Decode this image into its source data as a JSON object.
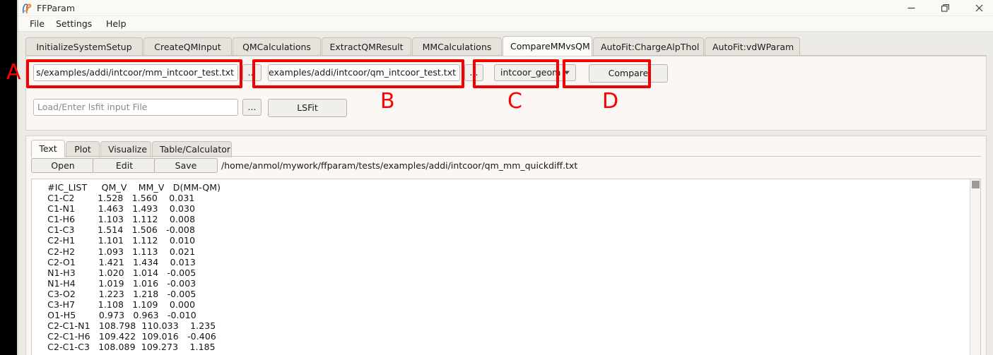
{
  "window": {
    "title": "FFParam",
    "icon": "ffparam-logo-icon",
    "controls": {
      "minimize": "–",
      "maximize": "❐",
      "close": "✕"
    }
  },
  "menubar": {
    "items": [
      {
        "label": "File"
      },
      {
        "label": "Settings"
      },
      {
        "label": "Help"
      }
    ]
  },
  "tabs": {
    "active": "CompareMMvsQM",
    "items": [
      {
        "label": "InitializeSystemSetup"
      },
      {
        "label": "CreateQMInput"
      },
      {
        "label": "QMCalculations"
      },
      {
        "label": "ExtractQMResult"
      },
      {
        "label": "MMCalculations"
      },
      {
        "label": "CompareMMvsQM"
      },
      {
        "label": "AutoFit:ChargeAlpThol"
      },
      {
        "label": "AutoFit:vdWParam"
      }
    ]
  },
  "compare_panel": {
    "mm_file": {
      "value": "s/examples/addi/intcoor/mm_intcoor_test.txt",
      "browse_label": "..."
    },
    "qm_file": {
      "value": "s/examples/addi/intcoor/qm_intcoor_test.txt",
      "browse_label": "..."
    },
    "mode_select": {
      "value": "intcoor_geom",
      "caret": "chevron-down-icon"
    },
    "compare_button": "Compare",
    "lsfit_file": {
      "value": "",
      "placeholder": "Load/Enter lsfit input File",
      "browse_label": "..."
    },
    "lsfit_button": "LSFit"
  },
  "annotations": [
    {
      "letter": "A"
    },
    {
      "letter": "B"
    },
    {
      "letter": "C"
    },
    {
      "letter": "D"
    }
  ],
  "result_panel": {
    "tabs": {
      "active": "Text",
      "items": [
        {
          "label": "Text"
        },
        {
          "label": "Plot"
        },
        {
          "label": "Visualize"
        },
        {
          "label": "Table/Calculator"
        }
      ]
    },
    "toolbar": {
      "open_label": "Open",
      "edit_label": "Edit",
      "save_label": "Save"
    },
    "file_path": "/home/anmol/mywork/ffparam/tests/examples/addi/intcoor/qm_mm_quickdiff.txt"
  },
  "text_content": {
    "header": [
      "#IC_LIST",
      "QM_V",
      "MM_V",
      "D(MM-QM)"
    ],
    "rows": [
      {
        "ic": "C1-C2",
        "qm": "1.528",
        "mm": "1.560",
        "d": "0.031"
      },
      {
        "ic": "C1-N1",
        "qm": "1.463",
        "mm": "1.493",
        "d": "0.030"
      },
      {
        "ic": "C1-H6",
        "qm": "1.103",
        "mm": "1.112",
        "d": "0.008"
      },
      {
        "ic": "C1-C3",
        "qm": "1.514",
        "mm": "1.506",
        "d": "-0.008"
      },
      {
        "ic": "C2-H1",
        "qm": "1.101",
        "mm": "1.112",
        "d": "0.010"
      },
      {
        "ic": "C2-H2",
        "qm": "1.093",
        "mm": "1.113",
        "d": "0.021"
      },
      {
        "ic": "C2-O1",
        "qm": "1.421",
        "mm": "1.434",
        "d": "0.013"
      },
      {
        "ic": "N1-H3",
        "qm": "1.020",
        "mm": "1.014",
        "d": "-0.005"
      },
      {
        "ic": "N1-H4",
        "qm": "1.019",
        "mm": "1.016",
        "d": "-0.003"
      },
      {
        "ic": "C3-O2",
        "qm": "1.223",
        "mm": "1.218",
        "d": "-0.005"
      },
      {
        "ic": "C3-H7",
        "qm": "1.108",
        "mm": "1.109",
        "d": "0.000"
      },
      {
        "ic": "O1-H5",
        "qm": "0.973",
        "mm": "0.963",
        "d": "-0.010"
      },
      {
        "ic": "C2-C1-N1",
        "qm": "108.798",
        "mm": "110.033",
        "d": "1.235"
      },
      {
        "ic": "C2-C1-H6",
        "qm": "109.422",
        "mm": "109.016",
        "d": "-0.406"
      },
      {
        "ic": "C2-C1-C3",
        "qm": "108.089",
        "mm": "109.273",
        "d": "1.185"
      }
    ],
    "rendered": "  #IC_LIST     QM_V    MM_V   D(MM-QM)\n  C1-C2        1.528   1.560    0.031\n  C1-N1        1.463   1.493    0.030\n  C1-H6        1.103   1.112    0.008\n  C1-C3        1.514   1.506   -0.008\n  C2-H1        1.101   1.112    0.010\n  C2-H2        1.093   1.113    0.021\n  C2-O1        1.421   1.434    0.013\n  N1-H3        1.020   1.014   -0.005\n  N1-H4        1.019   1.016   -0.003\n  C3-O2        1.223   1.218   -0.005\n  C3-H7        1.108   1.109    0.000\n  O1-H5        0.973   0.963   -0.010\n  C2-C1-N1   108.798  110.033    1.235\n  C2-C1-H6   109.422  109.016   -0.406\n  C2-C1-C3   108.089  109.273    1.185"
  },
  "colors": {
    "annotation_red": "#f40000",
    "panel_bg": "#fbf7f4",
    "window_bg": "#eceae4",
    "tab_active_bg": "#fdfbf8"
  }
}
